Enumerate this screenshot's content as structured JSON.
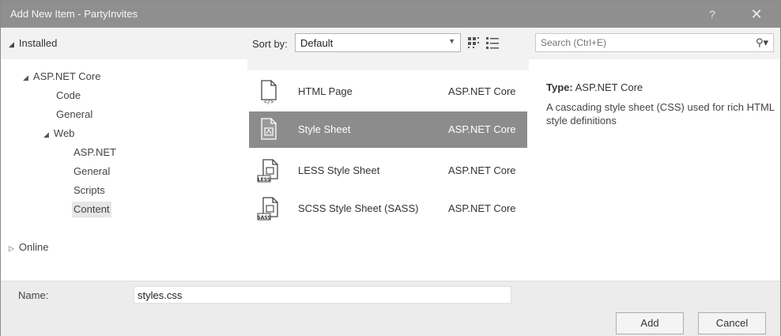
{
  "window": {
    "title": "Add New Item - PartyInvites",
    "help_glyph": "?",
    "close_glyph": "✕"
  },
  "left_panel": {
    "installed_label": "Installed",
    "tree": [
      {
        "label": "ASP.NET Core",
        "expanded": true
      },
      {
        "label": "Code"
      },
      {
        "label": "General"
      },
      {
        "label": "Web",
        "expanded": true
      },
      {
        "label": "ASP.NET"
      },
      {
        "label": "General"
      },
      {
        "label": "Scripts"
      },
      {
        "label": "Content",
        "selected": true
      }
    ],
    "online_label": "Online"
  },
  "toolbar": {
    "sort_label": "Sort by:",
    "sort_value": "Default",
    "grid_view_icon": "medium-icons-view-icon",
    "list_view_icon": "list-view-icon"
  },
  "search": {
    "placeholder": "Search (Ctrl+E)",
    "icon": "search-icon"
  },
  "templates": [
    {
      "name": "HTML Page",
      "category": "ASP.NET Core",
      "icon": "html-page-icon",
      "badge": "<​/>"
    },
    {
      "name": "Style Sheet",
      "category": "ASP.NET Core",
      "icon": "style-sheet-icon",
      "selected": true
    },
    {
      "name": "LESS Style Sheet",
      "category": "ASP.NET Core",
      "icon": "less-style-sheet-icon",
      "badge": "LESS"
    },
    {
      "name": "SCSS Style Sheet (SASS)",
      "category": "ASP.NET Core",
      "icon": "scss-style-sheet-icon",
      "badge": "SASS"
    }
  ],
  "details": {
    "type_label": "Type:",
    "type_value": "ASP.NET Core",
    "description": "A cascading style sheet (CSS) used for rich HTML style definitions"
  },
  "footer": {
    "name_label": "Name:",
    "name_value": "styles.css",
    "add_label": "Add",
    "cancel_label": "Cancel"
  },
  "colors": {
    "titlebar": "#8f8f8f",
    "selection": "#8c8c8c"
  }
}
